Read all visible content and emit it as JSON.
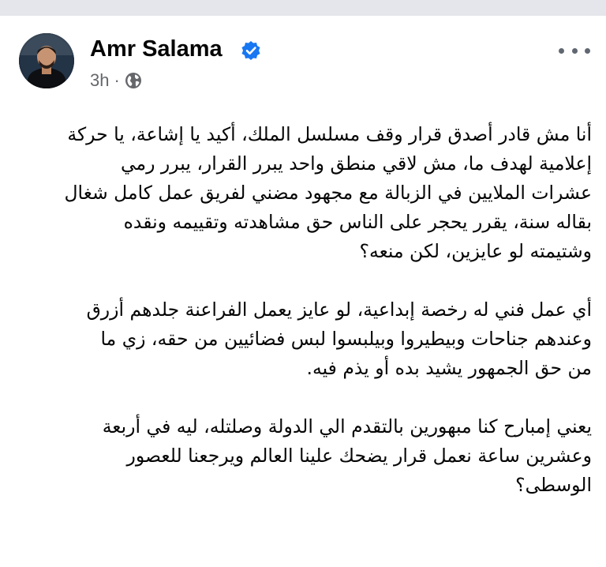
{
  "post": {
    "author_name": "Amr Salama",
    "verified": true,
    "time": "3h",
    "separator": "·",
    "visibility_icon": "globe-icon",
    "more_icon": "more-options-icon",
    "paragraphs": [
      {
        "lines": [
          "أنا مش قادر أصدق قرار وقف مسلسل الملك، أكيد يا إشاعة، يا حركة",
          "إعلامية لهدف ما، مش لاقي منطق واحد يبرر القرار، يبرر رمي",
          "عشرات الملايين في الزبالة مع مجهود مضني لفريق عمل كامل شغال",
          "بقاله سنة، يقرر يحجر على الناس حق مشاهدته وتقييمه ونقده",
          "وشتيمته لو عايزين، لكن منعه؟"
        ]
      },
      {
        "lines": [
          "أي عمل فني له رخصة إبداعية، لو عايز يعمل الفراعنة جلدهم أزرق",
          "وعندهم جناحات وبيطيروا وبيلبسوا لبس فضائيين من حقه، زي ما",
          "من حق الجمهور يشيد بده أو يذم فيه."
        ]
      },
      {
        "lines": [
          "يعني إمبارح كنا مبهورين بالتقدم الي الدولة وصلتله، ليه في أربعة",
          "وعشرين ساعة نعمل قرار يضحك علينا العالم ويرجعنا للعصور",
          "الوسطى؟"
        ]
      }
    ]
  },
  "colors": {
    "background": "#ffffff",
    "top_strip": "#e4e6eb",
    "name_text": "#050505",
    "meta_text": "#65676b",
    "verified_badge": "#1877f2"
  }
}
